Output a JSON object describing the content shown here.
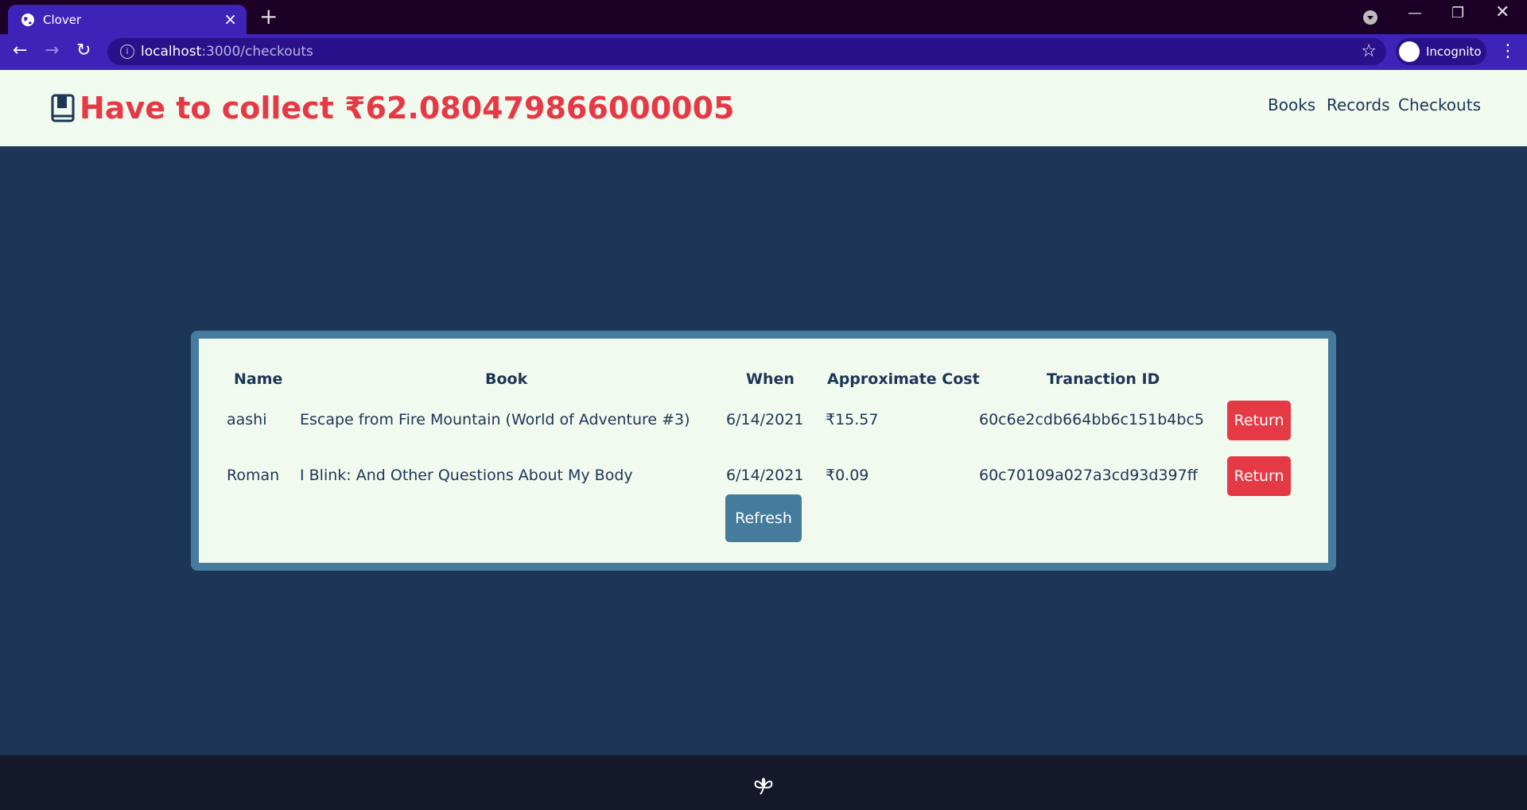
{
  "browser": {
    "tab_title": "Clover",
    "url_host": "localhost",
    "url_path": ":3000/checkouts",
    "profile_label": "Incognito"
  },
  "header": {
    "title": "Have to collect ₹62.080479866000005",
    "nav": [
      "Books",
      "Records",
      "Checkouts"
    ]
  },
  "table": {
    "columns": [
      "Name",
      "Book",
      "When",
      "Approximate Cost",
      "Tranaction ID"
    ],
    "rows": [
      {
        "name": "aashi",
        "book": "Escape from Fire Mountain (World of Adventure #3)",
        "when": "6/14/2021",
        "cost": "₹15.57",
        "txid": "60c6e2cdb664bb6c151b4bc5",
        "action": "Return"
      },
      {
        "name": "Roman",
        "book": "I Blink: And Other Questions About My Body",
        "when": "6/14/2021",
        "cost": "₹0.09",
        "txid": "60c70109a027a3cd93d397ff",
        "action": "Return"
      }
    ],
    "refresh_label": "Refresh"
  },
  "colors": {
    "brand_red": "#e63946",
    "background_navy": "#1d3557",
    "light": "#f1faee",
    "steel_blue": "#457b9d"
  }
}
